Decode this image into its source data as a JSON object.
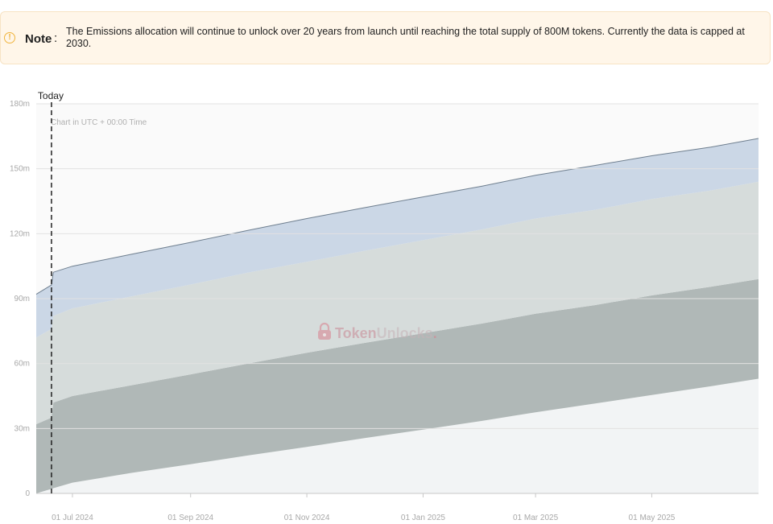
{
  "note": {
    "icon": "info-icon",
    "label": "Note",
    "colon": ":",
    "text": "The Emissions allocation will continue to unlock over 20 years from launch until reaching the total supply of 800M tokens. Currently the data is capped at 2030."
  },
  "watermark": {
    "icon": "lock-icon",
    "brand_part1": "Token",
    "brand_part2": "Unlocks",
    "brand_dot": "."
  },
  "chart_data": {
    "type": "area",
    "stacked": true,
    "timezone_label": "Chart in UTC + 00:00 Time",
    "today_label": "Today",
    "today_x": "2024-06-20",
    "y_ticks": [
      0,
      30,
      60,
      90,
      120,
      150,
      180
    ],
    "y_tick_labels": [
      "0",
      "30m",
      "60m",
      "90m",
      "120m",
      "150m",
      "180m"
    ],
    "ylim": [
      0,
      180
    ],
    "xlim": [
      "2024-06-12",
      "2025-06-26"
    ],
    "x_ticks": [
      "2024-07-01",
      "2024-09-01",
      "2024-11-01",
      "2025-01-01",
      "2025-03-01",
      "2025-05-01"
    ],
    "x_tick_labels": [
      "01 Jul 2024",
      "01 Sep 2024",
      "01 Nov 2024",
      "01 Jan 2025",
      "01 Mar 2025",
      "01 May 2025"
    ],
    "grid": true,
    "legend": "none",
    "x": [
      "2024-06-12",
      "2024-06-20",
      "2024-06-21",
      "2024-07-01",
      "2024-08-01",
      "2024-09-01",
      "2024-10-01",
      "2024-11-01",
      "2024-12-01",
      "2025-01-01",
      "2025-02-01",
      "2025-03-01",
      "2025-04-01",
      "2025-05-01",
      "2025-06-01",
      "2025-06-26"
    ],
    "series": [
      {
        "values": [
          0,
          2.1,
          2.4,
          5,
          9.5,
          13.5,
          17.5,
          21.5,
          25.5,
          29.5,
          33.5,
          37.5,
          41.5,
          45.5,
          49.5,
          53
        ],
        "color": "#f2f4f5"
      },
      {
        "values": [
          32,
          32.9,
          39.6,
          40,
          40.5,
          41.5,
          42.5,
          43.5,
          44,
          44.5,
          45,
          45.5,
          45.5,
          46,
          46,
          46
        ],
        "color": "#b0b8b7"
      },
      {
        "values": [
          40,
          41,
          40,
          40.5,
          41,
          41.5,
          42,
          42,
          42.5,
          43,
          43.5,
          44,
          44,
          44.5,
          44.5,
          45
        ],
        "color": "#d6dcdb"
      },
      {
        "values": [
          20,
          20.3,
          20.2,
          19.5,
          19.5,
          19.5,
          19.5,
          20,
          20,
          20,
          20,
          20,
          20.5,
          20,
          20,
          20
        ],
        "color": "#cbd7e6"
      }
    ]
  }
}
